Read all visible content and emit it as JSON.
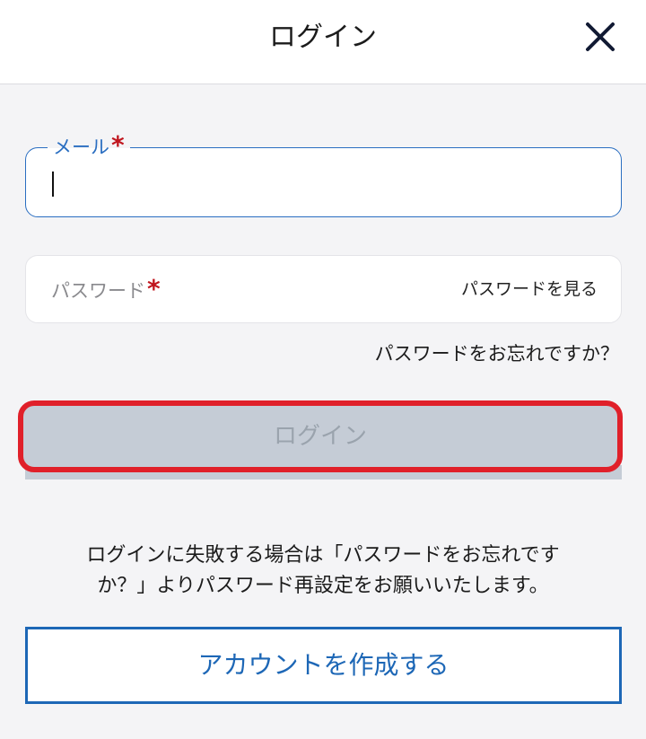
{
  "header": {
    "title": "ログイン",
    "close_icon": "close-icon"
  },
  "form": {
    "email": {
      "label": "メール",
      "required_mark": "*",
      "value": ""
    },
    "password": {
      "placeholder": "パスワード",
      "required_mark": "*",
      "show_password_label": "パスワードを見る"
    },
    "forgot_password_label": "パスワードをお忘れですか？",
    "login_button_label": "ログイン"
  },
  "info": {
    "line1": "ログインに失敗する場合は「パスワードをお忘れです",
    "line2": "か？」よりパスワード再設定をお願いいたします。"
  },
  "create_account_label": "アカウントを作成する",
  "colors": {
    "accent": "#1d67b6",
    "required": "#c0161e",
    "highlight": "#e0202a",
    "disabled_button": "#c5ccd6"
  }
}
